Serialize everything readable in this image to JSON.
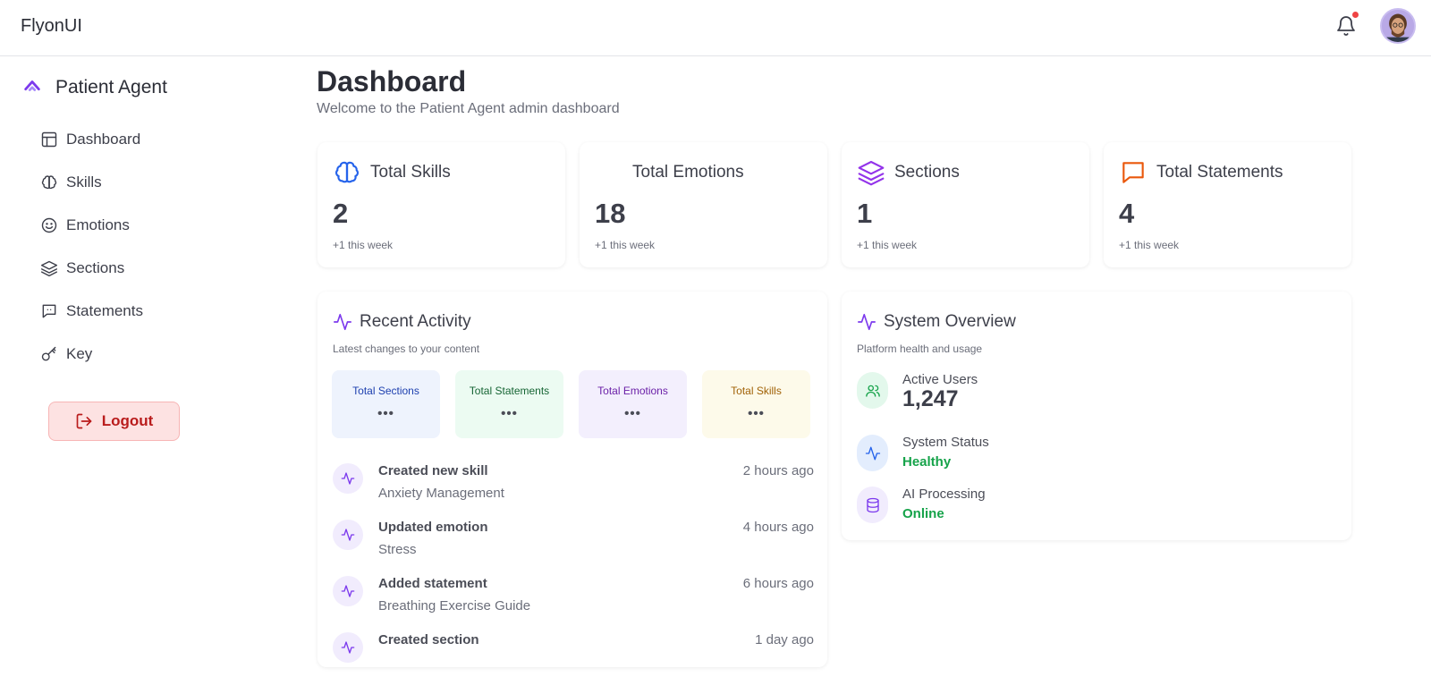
{
  "app": {
    "brand": "FlyonUI"
  },
  "sidebar": {
    "title": "Patient Agent",
    "items": [
      {
        "label": "Dashboard",
        "icon": "layout-icon"
      },
      {
        "label": "Skills",
        "icon": "brain-icon"
      },
      {
        "label": "Emotions",
        "icon": "smile-icon"
      },
      {
        "label": "Sections",
        "icon": "layers-icon"
      },
      {
        "label": "Statements",
        "icon": "message-icon"
      },
      {
        "label": "Key",
        "icon": "key-icon"
      }
    ],
    "logout_label": "Logout"
  },
  "main": {
    "title": "Dashboard",
    "subtitle": "Welcome to the Patient Agent admin dashboard"
  },
  "stats": [
    {
      "title": "Total Skills",
      "value": "2",
      "note": "+1 this week",
      "color": "#2563eb"
    },
    {
      "title": "Total Emotions",
      "value": "18",
      "note": "+1 this week",
      "color": "#eab308"
    },
    {
      "title": "Sections",
      "value": "1",
      "note": "+1 this week",
      "color": "#9333ea"
    },
    {
      "title": "Total Statements",
      "value": "4",
      "note": "+1 this week",
      "color": "#ea580c"
    }
  ],
  "recent": {
    "title": "Recent Activity",
    "subtitle": "Latest changes to your content",
    "minis": [
      {
        "label": "Total Sections",
        "value": "•••",
        "color": "#1e40af",
        "bg": "#eef3fd"
      },
      {
        "label": "Total Statements",
        "value": "•••",
        "color": "#166534",
        "bg": "#ecfbf2"
      },
      {
        "label": "Total Emotions",
        "value": "•••",
        "color": "#6b21a8",
        "bg": "#f3effd"
      },
      {
        "label": "Total Skills",
        "value": "•••",
        "color": "#a16207",
        "bg": "#fdfaea"
      }
    ],
    "items": [
      {
        "title": "Created new skill",
        "detail": "Anxiety Management",
        "time": "2 hours ago"
      },
      {
        "title": "Updated emotion",
        "detail": "Stress",
        "time": "4 hours ago"
      },
      {
        "title": "Added statement",
        "detail": "Breathing Exercise Guide",
        "time": "6 hours ago"
      },
      {
        "title": "Created section",
        "detail": "",
        "time": "1 day ago"
      }
    ]
  },
  "overview": {
    "title": "System Overview",
    "subtitle": "Platform health and usage",
    "items": [
      {
        "label": "Active Users",
        "value": "1,247"
      },
      {
        "label": "System Status",
        "value": "Healthy"
      },
      {
        "label": "AI Processing",
        "value": "Online"
      }
    ]
  }
}
